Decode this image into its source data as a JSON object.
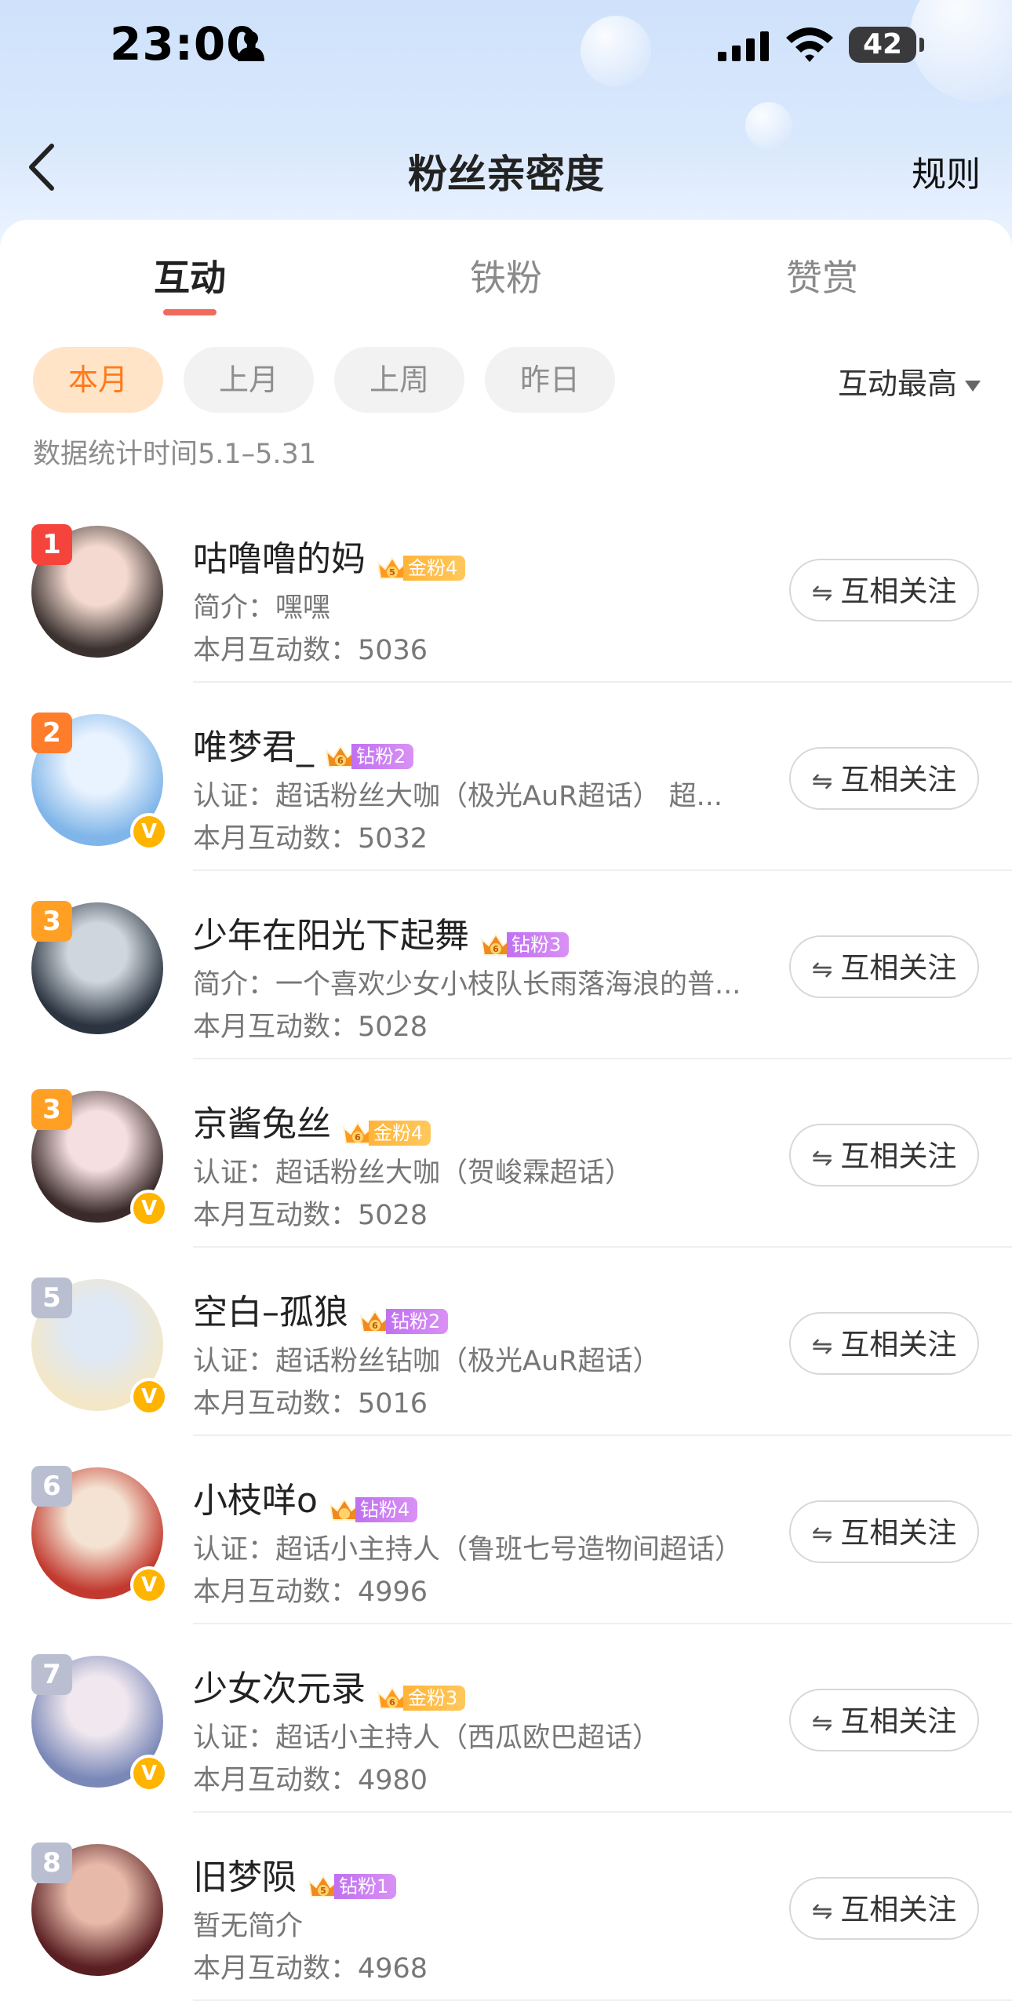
{
  "status_bar": {
    "time": "23:00",
    "battery": "42"
  },
  "nav": {
    "title": "粉丝亲密度",
    "rules_label": "规则"
  },
  "tabs": [
    {
      "label": "互动",
      "active": true
    },
    {
      "label": "铁粉",
      "active": false
    },
    {
      "label": "赞赏",
      "active": false
    }
  ],
  "filters": [
    "本月",
    "上月",
    "上周",
    "昨日"
  ],
  "sort_label": "互动最高",
  "stats_period": "数据统计时间5.1–5.31",
  "follow_label": "互相关注",
  "users": [
    {
      "rank": "1",
      "name": "咕噜噜的妈",
      "badge_level": "5",
      "badge_label": "金粉4",
      "badge_type": "gold",
      "desc": "简介：嘿嘿",
      "count": "本月互动数：5036",
      "verified": false
    },
    {
      "rank": "2",
      "name": "唯梦君_",
      "badge_level": "6",
      "badge_label": "钻粉2",
      "badge_type": "diamond",
      "desc": "认证：超话粉丝大咖（极光AuR超话） 超...",
      "count": "本月互动数：5032",
      "verified": true
    },
    {
      "rank": "3",
      "name": "少年在阳光下起舞",
      "badge_level": "6",
      "badge_label": "钻粉3",
      "badge_type": "diamond",
      "desc": "简介：一个喜欢少女小枝队长雨落海浪的普...",
      "count": "本月互动数：5028",
      "verified": false
    },
    {
      "rank": "3",
      "name": "京酱兔丝",
      "badge_level": "6",
      "badge_label": "金粉4",
      "badge_type": "gold",
      "desc": "认证：超话粉丝大咖（贺峻霖超话）",
      "count": "本月互动数：5028",
      "verified": true
    },
    {
      "rank": "5",
      "name": "空白–孤狼",
      "badge_level": "6",
      "badge_label": "钻粉2",
      "badge_type": "diamond",
      "desc": "认证：超话粉丝钻咖（极光AuR超话）",
      "count": "本月互动数：5016",
      "verified": true
    },
    {
      "rank": "6",
      "name": "小枝咩o",
      "badge_level": "",
      "badge_label": "钻粉4",
      "badge_type": "diamond",
      "desc": "认证：超话小主持人（鲁班七号造物间超话）",
      "count": "本月互动数：4996",
      "verified": true
    },
    {
      "rank": "7",
      "name": "少女次元录",
      "badge_level": "6",
      "badge_label": "金粉3",
      "badge_type": "gold",
      "desc": "认证：超话小主持人（西瓜欧巴超话）",
      "count": "本月互动数：4980",
      "verified": true
    },
    {
      "rank": "8",
      "name": "旧梦陨",
      "badge_level": "5",
      "badge_label": "钻粉1",
      "badge_type": "diamond",
      "desc": "暂无简介",
      "count": "本月互动数：4968",
      "verified": false
    }
  ],
  "colors": {
    "accent": "#f06a5e",
    "active_filter_bg": "#ffe4c8",
    "active_filter_text": "#ff7a1a",
    "rank_1": "#f5443c",
    "rank_2": "#ff7c2a",
    "rank_3": "#ffa025",
    "rank_other": "#b9bfd0",
    "verified": "#ffb400"
  }
}
